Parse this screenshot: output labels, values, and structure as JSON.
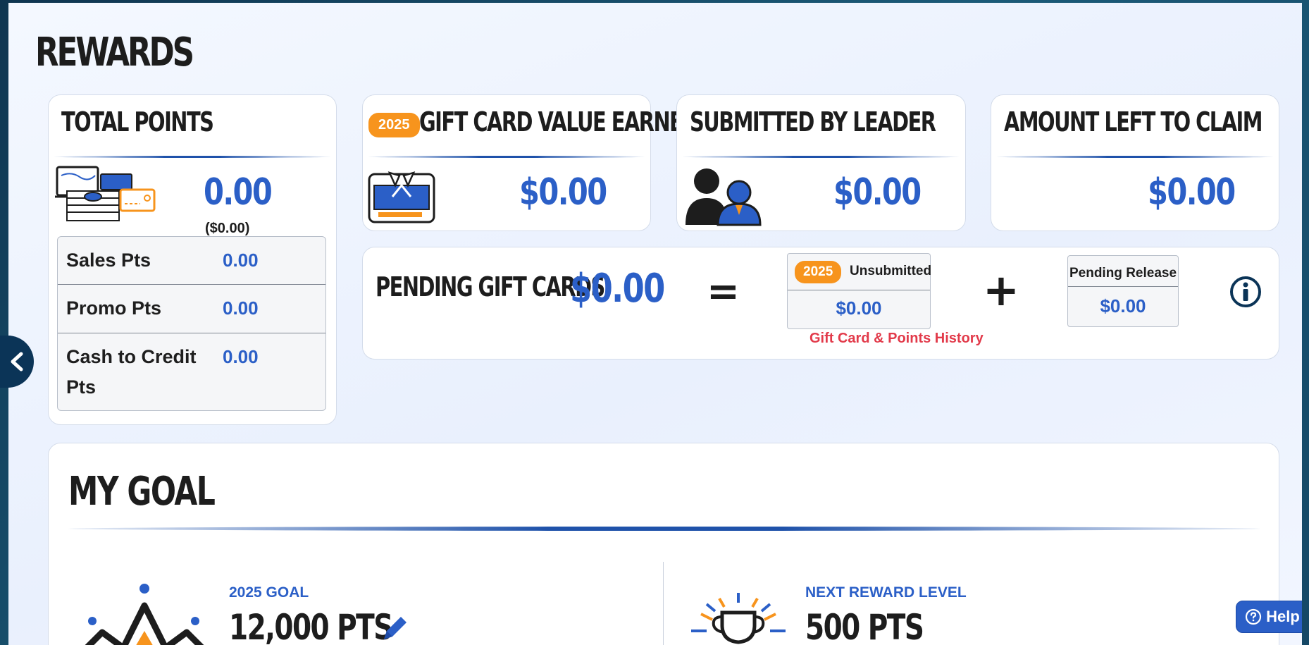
{
  "page": {
    "title": "REWARDS"
  },
  "total_points": {
    "title": "TOTAL POINTS",
    "value": "0.00",
    "dollar_value": "($0.00)",
    "rows": [
      {
        "label": "Sales Pts",
        "value": "0.00"
      },
      {
        "label": "Promo Pts",
        "value": "0.00"
      },
      {
        "label_line1": "Cash to Credit",
        "label_line2": "Pts",
        "value": "0.00"
      }
    ]
  },
  "gift_card_earned": {
    "year": "2025",
    "title": "GIFT CARD VALUE EARNED",
    "value": "$0.00"
  },
  "submitted_by_leader": {
    "title": "SUBMITTED BY LEADER",
    "value": "$0.00"
  },
  "amount_left": {
    "title": "AMOUNT LEFT TO CLAIM",
    "value": "$0.00"
  },
  "pending": {
    "title": "PENDING GIFT CARDS",
    "value": "$0.00",
    "equals": "=",
    "plus": "+",
    "unsubmitted": {
      "year": "2025",
      "label": "Unsubmitted",
      "value": "$0.00"
    },
    "pending_release": {
      "label": "Pending Release",
      "value": "$0.00"
    },
    "history_link": "Gift Card & Points History"
  },
  "goal": {
    "title": "MY GOAL",
    "year_goal_label": "2025 GOAL",
    "year_goal_value": "12,000 PTS",
    "next_level_label": "NEXT REWARD LEVEL",
    "next_level_value": "500 PTS"
  },
  "help": {
    "label": "Help"
  },
  "icons": [
    "cash-stack-icon",
    "gift-card-icon",
    "leader-users-icon",
    "info-icon",
    "crown-icon",
    "trophy-icon",
    "pencil-icon",
    "chevron-left-icon",
    "question-circle-icon"
  ],
  "colors": {
    "accent_blue": "#2b5fc7",
    "badge_orange": "#f7941d",
    "link_red": "#e23a4a",
    "dark_navy": "#0b3457"
  }
}
